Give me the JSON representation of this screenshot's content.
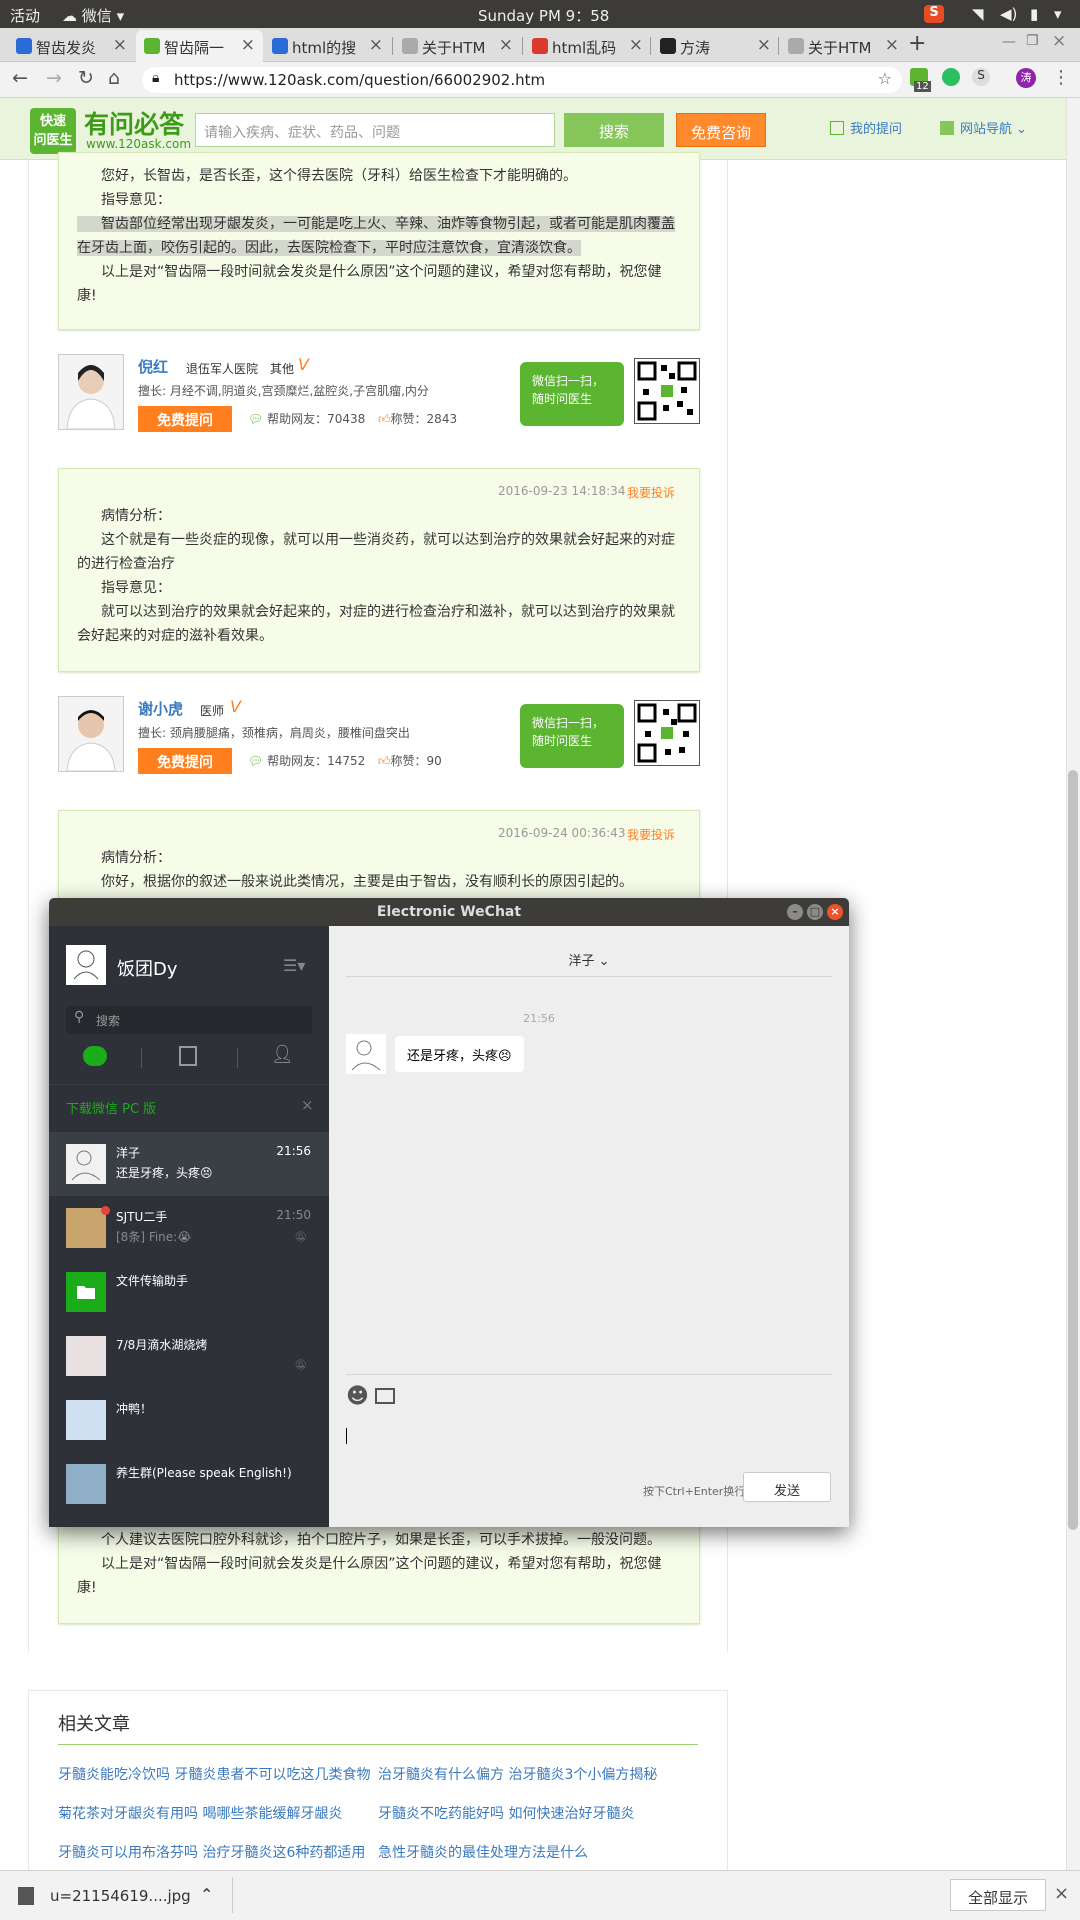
{
  "ubuntu": {
    "activities": "活动",
    "app": "微信",
    "clock": "Sunday PM 9：58"
  },
  "tabs": [
    {
      "label": "智齿发炎"
    },
    {
      "label": "智齿隔一"
    },
    {
      "label": "html的搜"
    },
    {
      "label": "关于HTM"
    },
    {
      "label": "html乱码"
    },
    {
      "label": "方涛"
    },
    {
      "label": "关于HTM"
    }
  ],
  "browser": {
    "url": "https://www.120ask.com/question/66002902.htm",
    "ext_badge": "12",
    "profile": "涛"
  },
  "site": {
    "logo_top": "快速",
    "logo_bottom": "问医生",
    "brand": "有问必答",
    "domain": "www.120ask.com",
    "search_placeholder": "请输入疾病、症状、药品、问题",
    "search_button": "搜索",
    "consult_button": "免费咨询",
    "my_questions": "我的提问",
    "site_nav": "网站导航"
  },
  "answer1": {
    "line1": "您好，长智齿，是否长歪，这个得去医院（牙科）给医生检查下才能明确的。",
    "guide_label": "指导意见：",
    "guide_a": "智齿部位经常出现牙龈发炎，一可能是吃上火、辛辣、油炸等食物引起，或者可能是肌肉覆盖",
    "guide_b": "在牙齿上面，咬伤引起的。因此，去医院检查下，平时应注意饮食，宜清淡饮食。",
    "closing_a": "以上是对“智齿隔一段时间就会发炎是什么原因”这个问题的建议，希望对您有帮助，祝您健",
    "closing_b": "康!"
  },
  "doctor1": {
    "name": "倪红",
    "hospital": "退伍军人医院",
    "title": "其他",
    "skills": "擅长: 月经不调,阴道炎,宫颈糜烂,盆腔炎,子宫肌瘤,内分",
    "free_button": "免费提问",
    "helped": "帮助网友：70438",
    "likes": "称赞：2843",
    "wx_tip_a": "微信扫一扫，",
    "wx_tip_b": "随时问医生"
  },
  "answer2": {
    "date": "2016-09-23 14:18:34",
    "complaint": "我要投诉",
    "analysis_label": "病情分析：",
    "analysis_a": "这个就是有一些炎症的现像，就可以用一些消炎药，就可以达到治疗的效果就会好起来的对症",
    "analysis_b": "的进行检查治疗",
    "guide_label": "指导意见：",
    "guide_a": "就可以达到治疗的效果就会好起来的，对症的进行检查治疗和滋补，就可以达到治疗的效果就",
    "guide_b": "会好起来的对症的滋补看效果。"
  },
  "doctor2": {
    "name": "谢小虎",
    "title": "医师",
    "skills": "擅长: 颈肩腰腿痛，颈椎病，肩周炎，腰椎间盘突出",
    "free_button": "免费提问",
    "helped": "帮助网友：14752",
    "likes": "称赞：90",
    "wx_tip_a": "微信扫一扫，",
    "wx_tip_b": "随时问医生"
  },
  "answer3": {
    "date": "2016-09-24 00:36:43",
    "complaint": "我要投诉",
    "analysis_label": "病情分析：",
    "analysis_a": "你好，根据你的叙述一般来说此类情况，主要是由于智齿，没有顺利长的原因引起的。",
    "suggest": "个人建议去医院口腔外科就诊，拍个口腔片子，如果是长歪，可以手术拔掉。一般没问题。",
    "closing_a": "以上是对“智齿隔一段时间就会发炎是什么原因”这个问题的建议，希望对您有帮助，祝您健",
    "closing_b": "康!"
  },
  "related": {
    "heading": "相关文章",
    "links": [
      [
        "牙髓炎能吃冷饮吗 牙髓炎患者不可以吃这几类食物",
        "治牙髓炎有什么偏方 治牙髓炎3个小偏方揭秘"
      ],
      [
        "菊花茶对牙龈炎有用吗 喝哪些茶能缓解牙龈炎",
        "牙髓炎不吃药能好吗 如何快速治好牙髓炎"
      ],
      [
        "牙髓炎可以用布洛芬吗 治疗牙髓炎这6种药都适用",
        "急性牙髓炎的最佳处理方法是什么"
      ]
    ]
  },
  "download": {
    "file": "u=21154619....jpg",
    "show_all": "全部显示"
  },
  "wechat": {
    "title": "Electronic WeChat",
    "user": "饭团Dy",
    "search_placeholder": "搜索",
    "download_banner": "下载微信 PC 版",
    "chats": [
      {
        "name": "洋子",
        "msg": "还是牙疼，头疼😣",
        "time": "21:56"
      },
      {
        "name": "SJTU二手",
        "msg": "[8条] Fine:😭",
        "time": "21:50"
      },
      {
        "name": "文件传输助手",
        "msg": "",
        "time": ""
      },
      {
        "name": "7/8月滴水湖烧烤",
        "msg": "",
        "time": ""
      },
      {
        "name": "冲鸭！",
        "msg": "",
        "time": ""
      },
      {
        "name": "养生群(Please speak English!)",
        "msg": "",
        "time": ""
      }
    ],
    "conversation": {
      "contact": "洋子",
      "time": "21:56",
      "message": "还是牙疼，头疼😣"
    },
    "hint": "按下Ctrl+Enter换行",
    "send": "发送"
  },
  "colors": {
    "site_green": "#5cb531",
    "accent_orange": "#ff7f1f",
    "wechat_green": "#1aad19",
    "link_blue": "#3a7abf"
  }
}
